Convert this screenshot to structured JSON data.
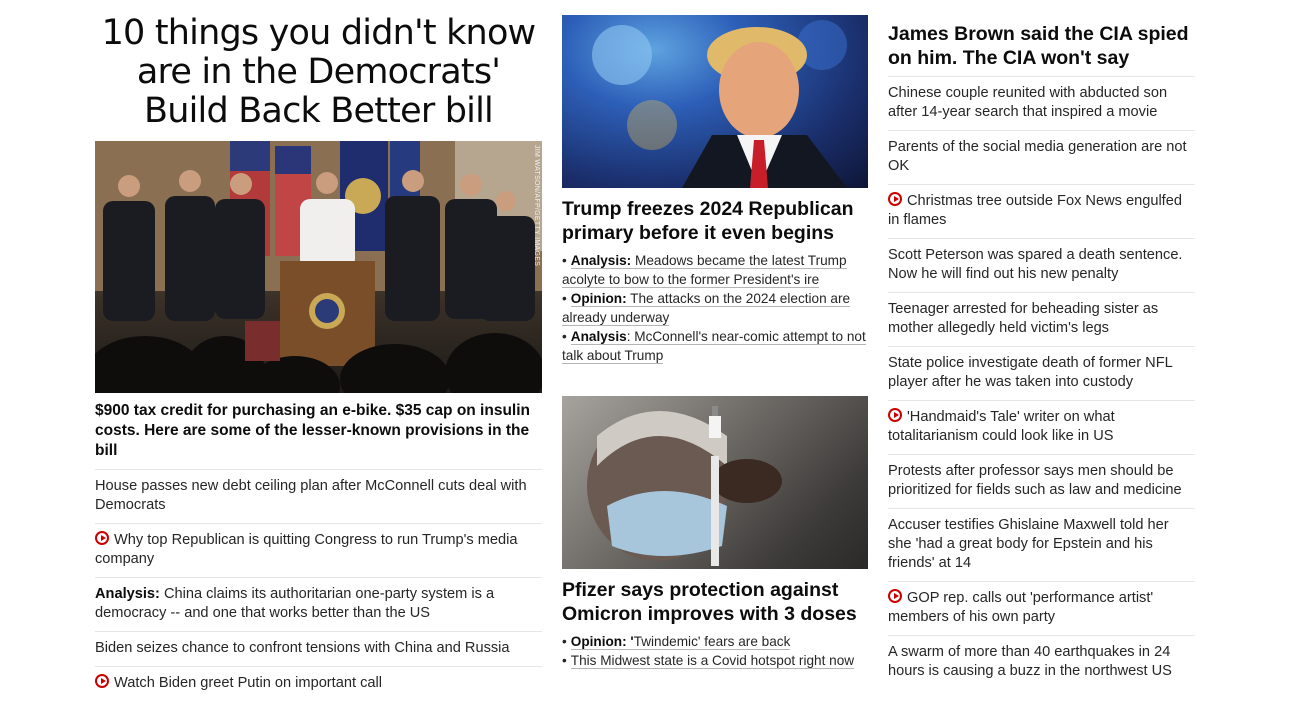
{
  "left": {
    "headline": "10 things you didn't know are in the Democrats' Build Back Better bill",
    "photo_credit": "JIM WATSON/AFP/GETTY IMAGES",
    "caption": "$900 tax credit for purchasing an e-bike. $35 cap on insulin costs. Here are some of the lesser-known provisions in the bill",
    "items": [
      {
        "prefix": "",
        "text": "House passes new debt ceiling plan after McConnell cuts deal with Democrats",
        "video": false
      },
      {
        "prefix": "",
        "text": "Why top Republican is quitting Congress to run Trump's media company",
        "video": true
      },
      {
        "prefix": "Analysis:",
        "text": " China claims its authoritarian one-party system is a democracy -- and one that works better than the US",
        "video": false
      },
      {
        "prefix": "",
        "text": "Biden seizes chance to confront tensions with China and Russia",
        "video": false
      },
      {
        "prefix": "",
        "text": "Watch Biden greet Putin on important call",
        "video": true
      }
    ]
  },
  "middle": {
    "story1": {
      "headline": "Trump freezes 2024 Republican primary before it even begins",
      "links": [
        {
          "label": "Analysis:",
          "text": " Meadows became the latest Trump acolyte to bow to the former President's ire"
        },
        {
          "label": "Opinion:",
          "text": " The attacks on the 2024 election are already underway"
        },
        {
          "label": "Analysis",
          "text": ": McConnell's near-comic attempt to not talk about Trump"
        }
      ]
    },
    "story2": {
      "headline": "Pfizer says protection against Omicron improves with 3 doses",
      "links": [
        {
          "label": "Opinion: '",
          "text": "Twindemic' fears are back"
        },
        {
          "label": "",
          "text": "This Midwest state is a Covid hotspot right now"
        }
      ]
    }
  },
  "right": {
    "headline": "James Brown said the CIA spied on him. The CIA won't say",
    "items": [
      {
        "text": "Chinese couple reunited with abducted son after 14-year search that inspired a movie",
        "video": false
      },
      {
        "text": "Parents of the social media generation are not OK",
        "video": false
      },
      {
        "text": "Christmas tree outside Fox News engulfed in flames",
        "video": true
      },
      {
        "text": "Scott Peterson was spared a death sentence. Now he will find out his new penalty",
        "video": false
      },
      {
        "text": "Teenager arrested for beheading sister as mother allegedly held victim's legs",
        "video": false
      },
      {
        "text": "State police investigate death of former NFL player after he was taken into custody",
        "video": false
      },
      {
        "text": "'Handmaid's Tale' writer on what totalitarianism could look like in US",
        "video": true
      },
      {
        "text": "Protests after professor says men should be prioritized for fields such as law and medicine",
        "video": false
      },
      {
        "text": "Accuser testifies Ghislaine Maxwell told her she 'had a great body for Epstein and his friends' at 14",
        "video": false
      },
      {
        "text": "GOP rep. calls out 'performance artist' members of his own party",
        "video": true
      },
      {
        "text": "A swarm of more than 40 earthquakes in 24 hours is causing a buzz in the northwest US",
        "video": false
      }
    ]
  },
  "colors": {
    "video_icon": "#cc0000",
    "divider": "#e6e6e6",
    "headline": "#0c0c0c",
    "text": "#262626"
  },
  "icons": {
    "video": "play-circle-icon"
  }
}
